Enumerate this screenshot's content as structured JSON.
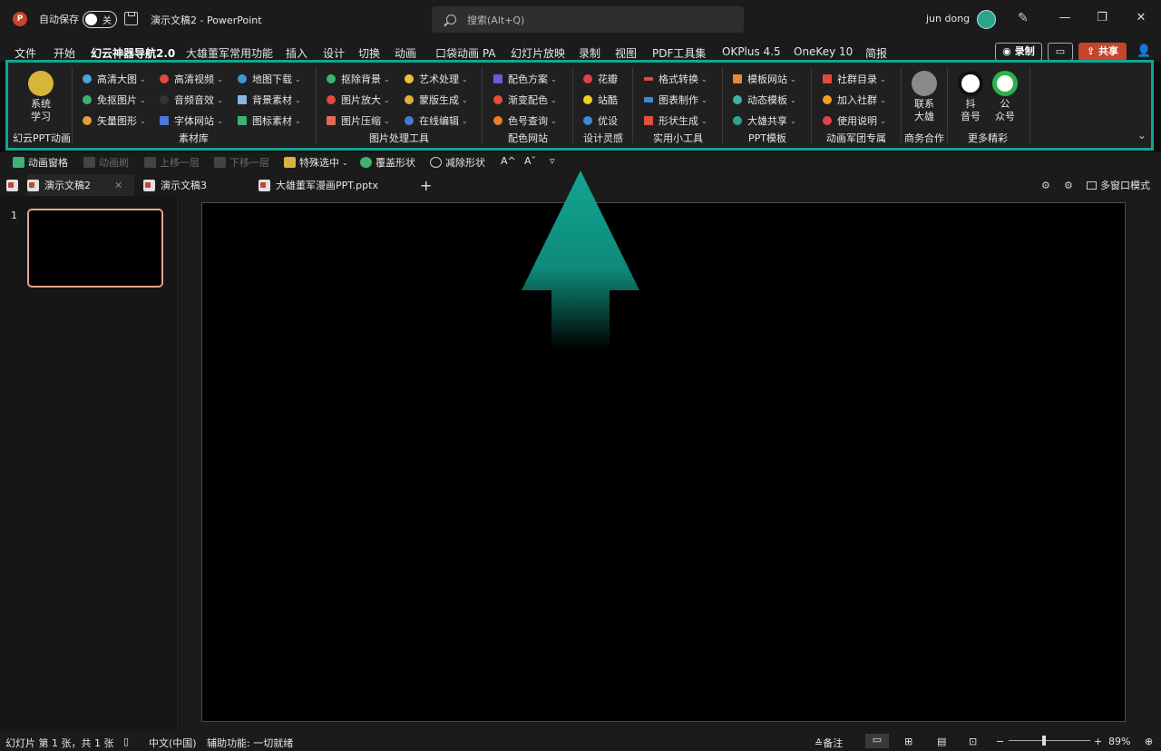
{
  "titlebar": {
    "app_logo": "P",
    "autosave_label": "自动保存",
    "autosave_state": "关",
    "doc_title": "演示文稿2  -  PowerPoint",
    "search_placeholder": "搜索(Alt+Q)",
    "user_name": "jun dong"
  },
  "menu": {
    "items": [
      "文件",
      "开始",
      "幻云神器导航2.0",
      "大雄董军常用功能",
      "插入",
      "设计",
      "切换",
      "动画",
      "口袋动画 PA",
      "幻灯片放映",
      "录制",
      "视图",
      "PDF工具集",
      "OKPlus 4.5",
      "OneKey 10",
      "简报"
    ],
    "record_label": "◉ 录制",
    "share_label": "⇪ 共享"
  },
  "ribbon": {
    "btn_system": "系统\n学习",
    "btn_system_l1": "系统",
    "btn_system_l2": "学习",
    "groups": [
      "幻云PPT动画",
      "素材库",
      "图片处理工具",
      "配色网站",
      "设计灵感",
      "实用小工具",
      "PPT模板",
      "动画军团专属",
      "商务合作",
      "更多精彩"
    ],
    "col1": [
      "高清大图",
      "免抠图片",
      "矢量图形"
    ],
    "col2": [
      "高清视频",
      "音频音效",
      "字体网站"
    ],
    "col3": [
      "地图下载",
      "背景素材",
      "图标素材"
    ],
    "col4": [
      "抠除背景",
      "图片放大",
      "图片压缩"
    ],
    "col5": [
      "艺术处理",
      "蒙版生成",
      "在线编辑"
    ],
    "col6": [
      "配色方案",
      "渐变配色",
      "色号查询"
    ],
    "col7": [
      "花瓣",
      "站酷",
      "优设"
    ],
    "col8": [
      "格式转换",
      "图表制作",
      "形状生成"
    ],
    "col9": [
      "模板网站",
      "动态模板",
      "大雄共享"
    ],
    "col10": [
      "社群目录",
      "加入社群",
      "使用说明"
    ],
    "contact_l1": "联系",
    "contact_l2": "大雄",
    "douyin_l1": "抖",
    "douyin_l2": "音号",
    "gzh_l1": "公",
    "gzh_l2": "众号"
  },
  "qat": {
    "items": [
      "动画窗格",
      "动画刷",
      "上移一层",
      "下移一层",
      "特殊选中",
      "覆盖形状",
      "减除形状"
    ],
    "font_up": "A^",
    "font_down": "Aˇ",
    "more": "▿"
  },
  "tabs": {
    "items": [
      "演示文稿2",
      "演示文稿3",
      "大雄董军漫画PPT.pptx"
    ],
    "add": "+",
    "multiwindow": "多窗口模式"
  },
  "slides": {
    "number": "1"
  },
  "status": {
    "slide_info": "幻灯片 第 1 张，共 1 张",
    "language": "中文(中国)",
    "accessibility": "辅助功能: 一切就绪",
    "notes": "备注",
    "zoom_minus": "−",
    "zoom_plus": "+",
    "zoom": "89%"
  },
  "colors": {
    "accent_teal": "#12a592",
    "share_red": "#c4452e",
    "thumb_border": "#e3a58a"
  }
}
